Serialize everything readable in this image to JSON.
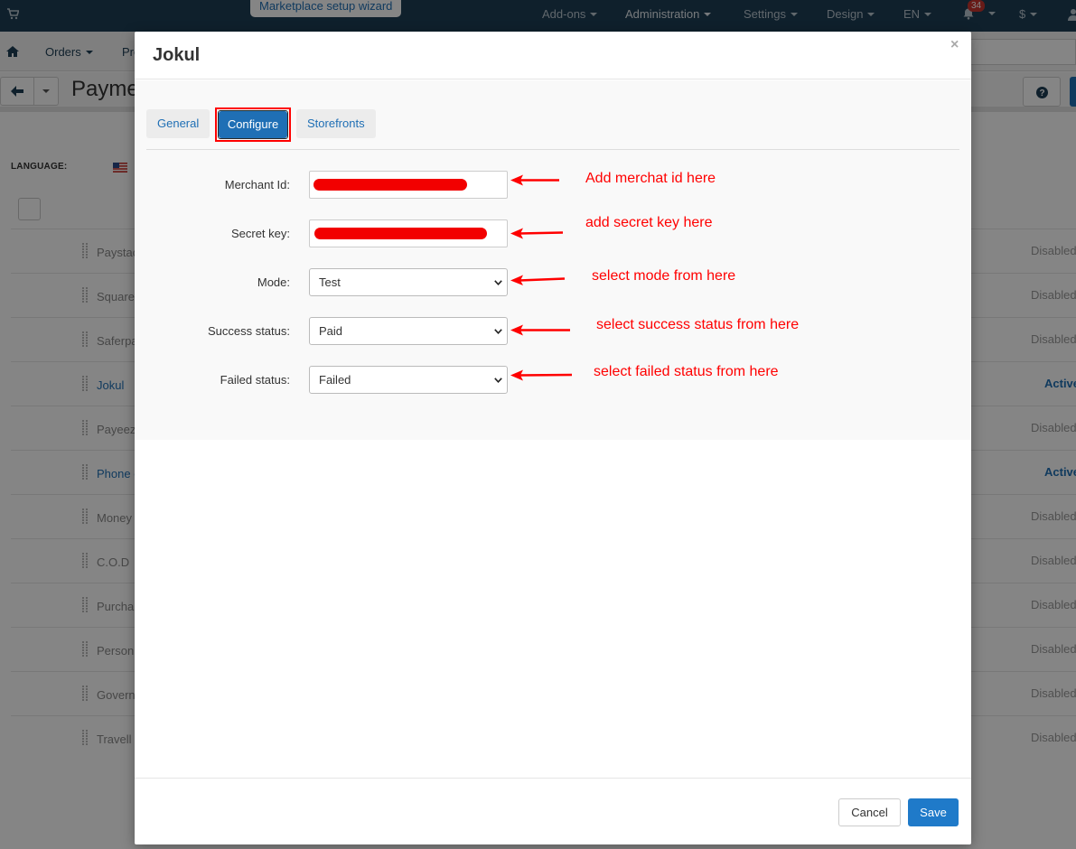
{
  "topbar": {
    "wizard_label": "Marketplace setup wizard",
    "menu": [
      "Add-ons",
      "Administration",
      "Settings",
      "Design",
      "EN",
      "$"
    ],
    "notification_count": "34"
  },
  "subbar": {
    "items": [
      "Orders",
      "Pro"
    ]
  },
  "page": {
    "title": "Payme"
  },
  "list": {
    "language_label": "LANGUAGE:",
    "rows": [
      {
        "name": "Paystac",
        "status": "Disabled",
        "active": false
      },
      {
        "name": "Square",
        "status": "Disabled",
        "active": false
      },
      {
        "name": "Saferpa",
        "status": "Disabled",
        "active": false
      },
      {
        "name": "Jokul",
        "status": "Active",
        "active": true
      },
      {
        "name": "Payeez",
        "status": "Disabled",
        "active": false
      },
      {
        "name": "Phone o",
        "status": "Active",
        "active": true
      },
      {
        "name": "Money",
        "status": "Disabled",
        "active": false
      },
      {
        "name": "C.O.D",
        "status": "Disabled",
        "active": false
      },
      {
        "name": "Purcha",
        "status": "Disabled",
        "active": false
      },
      {
        "name": "Person",
        "status": "Disabled",
        "active": false
      },
      {
        "name": "Govern",
        "status": "Disabled",
        "active": false
      },
      {
        "name": "Travell",
        "status": "Disabled",
        "active": false
      }
    ]
  },
  "modal": {
    "title": "Jokul",
    "close": "×",
    "tabs": [
      "General",
      "Configure",
      "Storefronts"
    ],
    "fields": {
      "merchant_label": "Merchant Id:",
      "secret_label": "Secret key:",
      "mode_label": "Mode:",
      "mode_value": "Test",
      "success_label": "Success status:",
      "success_value": "Paid",
      "failed_label": "Failed status:",
      "failed_value": "Failed"
    },
    "annotations": [
      "Add merchat id here",
      "add secret key here",
      "select mode from here",
      "select success status from here",
      "select failed status from here"
    ],
    "cancel_label": "Cancel",
    "save_label": "Save"
  },
  "colors": {
    "topbar": "#1d3e55",
    "primary": "#1f6fb5",
    "annotation": "#ff0000"
  }
}
